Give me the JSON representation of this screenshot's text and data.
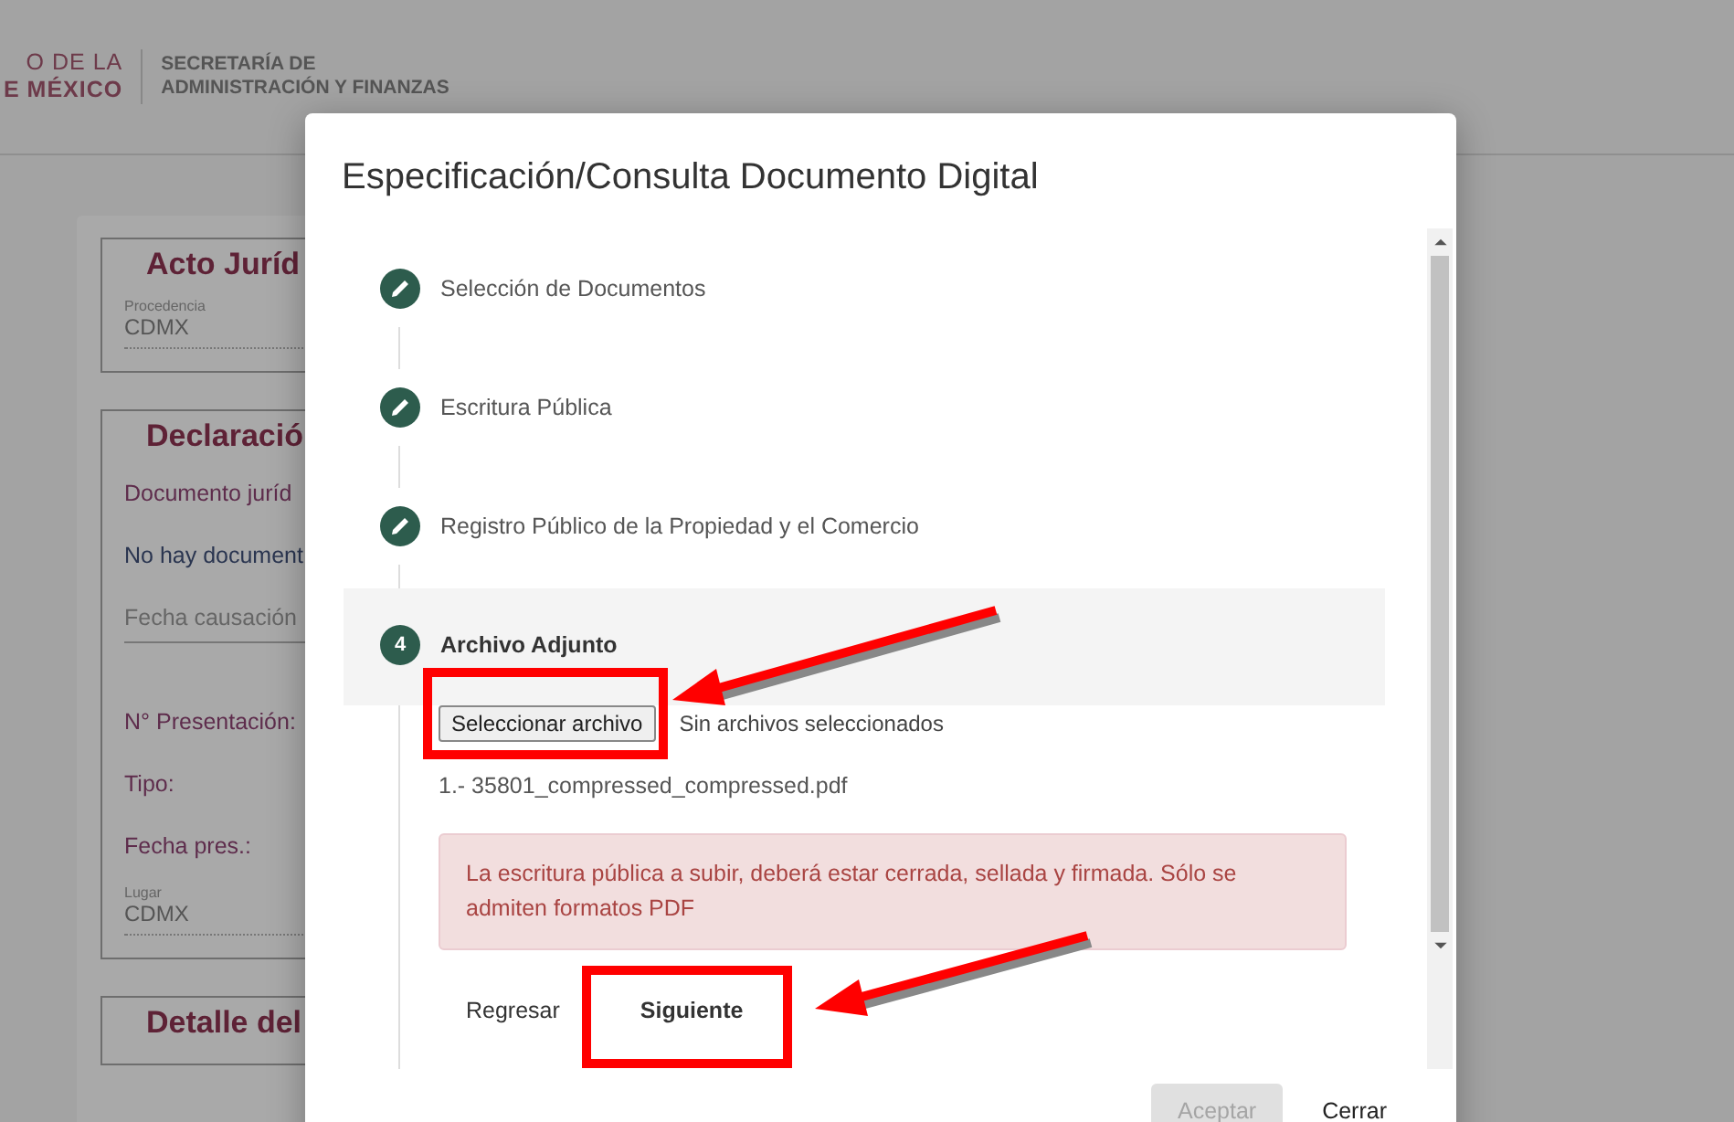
{
  "header": {
    "logo_lines": [
      "O DE LA",
      "E MÉXICO"
    ],
    "agency_lines": [
      "SECRETARÍA DE",
      "ADMINISTRACIÓN Y FINANZAS"
    ]
  },
  "background_sections": [
    {
      "title": "Acto Juríd",
      "items": [
        {
          "kind": "field",
          "label": "Procedencia",
          "value": "CDMX"
        }
      ]
    },
    {
      "title": "Declaració",
      "items": [
        {
          "kind": "label",
          "text": "Documento juríd"
        },
        {
          "kind": "text",
          "text": "No hay document"
        },
        {
          "kind": "input",
          "placeholder": "Fecha causación"
        },
        {
          "kind": "label",
          "text": "N° Presentación:"
        },
        {
          "kind": "label",
          "text": "Tipo:"
        },
        {
          "kind": "label",
          "text": "Fecha pres.:"
        },
        {
          "kind": "field",
          "label": "Lugar",
          "value": "CDMX"
        }
      ]
    },
    {
      "title": "Detalle del"
    }
  ],
  "dialog": {
    "title": "Especificación/Consulta Documento Digital",
    "steps": [
      {
        "kind": "edited",
        "title": "Selección de Documentos",
        "selected": false
      },
      {
        "kind": "edited",
        "title": "Escritura Pública",
        "selected": false
      },
      {
        "kind": "edited",
        "title": "Registro Público de la Propiedad y el Comercio",
        "selected": false
      },
      {
        "kind": "numbered",
        "number": "4",
        "title": "Archivo Adjunto",
        "selected": true
      }
    ],
    "file_button": "Seleccionar archivo",
    "file_status": "Sin archivos seleccionados",
    "file_name": "1.- 35801_compressed_compressed.pdf",
    "alert": "La escritura pública a subir, deberá estar cerrada, sellada y firmada. Sólo se admiten formatos PDF",
    "step_buttons": [
      "Regresar",
      "Siguiente"
    ],
    "footer_buttons": [
      {
        "label": "Aceptar",
        "disabled": true
      },
      {
        "label": "Cerrar",
        "disabled": false
      }
    ]
  }
}
